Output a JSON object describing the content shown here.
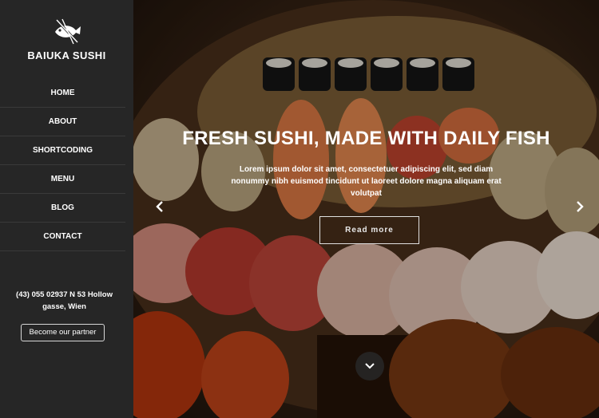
{
  "brand": {
    "name": "BAIUKA SUSHI",
    "logo_icon": "fish-chopsticks-icon"
  },
  "nav": [
    {
      "label": "HOME"
    },
    {
      "label": "ABOUT"
    },
    {
      "label": "SHORTCODING"
    },
    {
      "label": "MENU"
    },
    {
      "label": "BLOG"
    },
    {
      "label": "CONTACT"
    }
  ],
  "contact": {
    "address_line1": "(43) 055 02937 N 53 Hollow",
    "address_line2": "gasse, Wien"
  },
  "partner_button": "Become our partner",
  "hero": {
    "title": "FRESH SUSHI, MADE WITH DAILY FISH",
    "subtitle": "Lorem ipsum dolor sit amet, consectetuer adipiscing elit, sed diam nonummy nibh euismod tincidunt ut laoreet dolore magna aliquam erat volutpat",
    "button": "Read more",
    "prev_icon": "chevron-left-icon",
    "next_icon": "chevron-right-icon",
    "scroll_icon": "chevron-down-icon"
  },
  "colors": {
    "sidebar_bg": "#262626",
    "text": "#ffffff"
  }
}
